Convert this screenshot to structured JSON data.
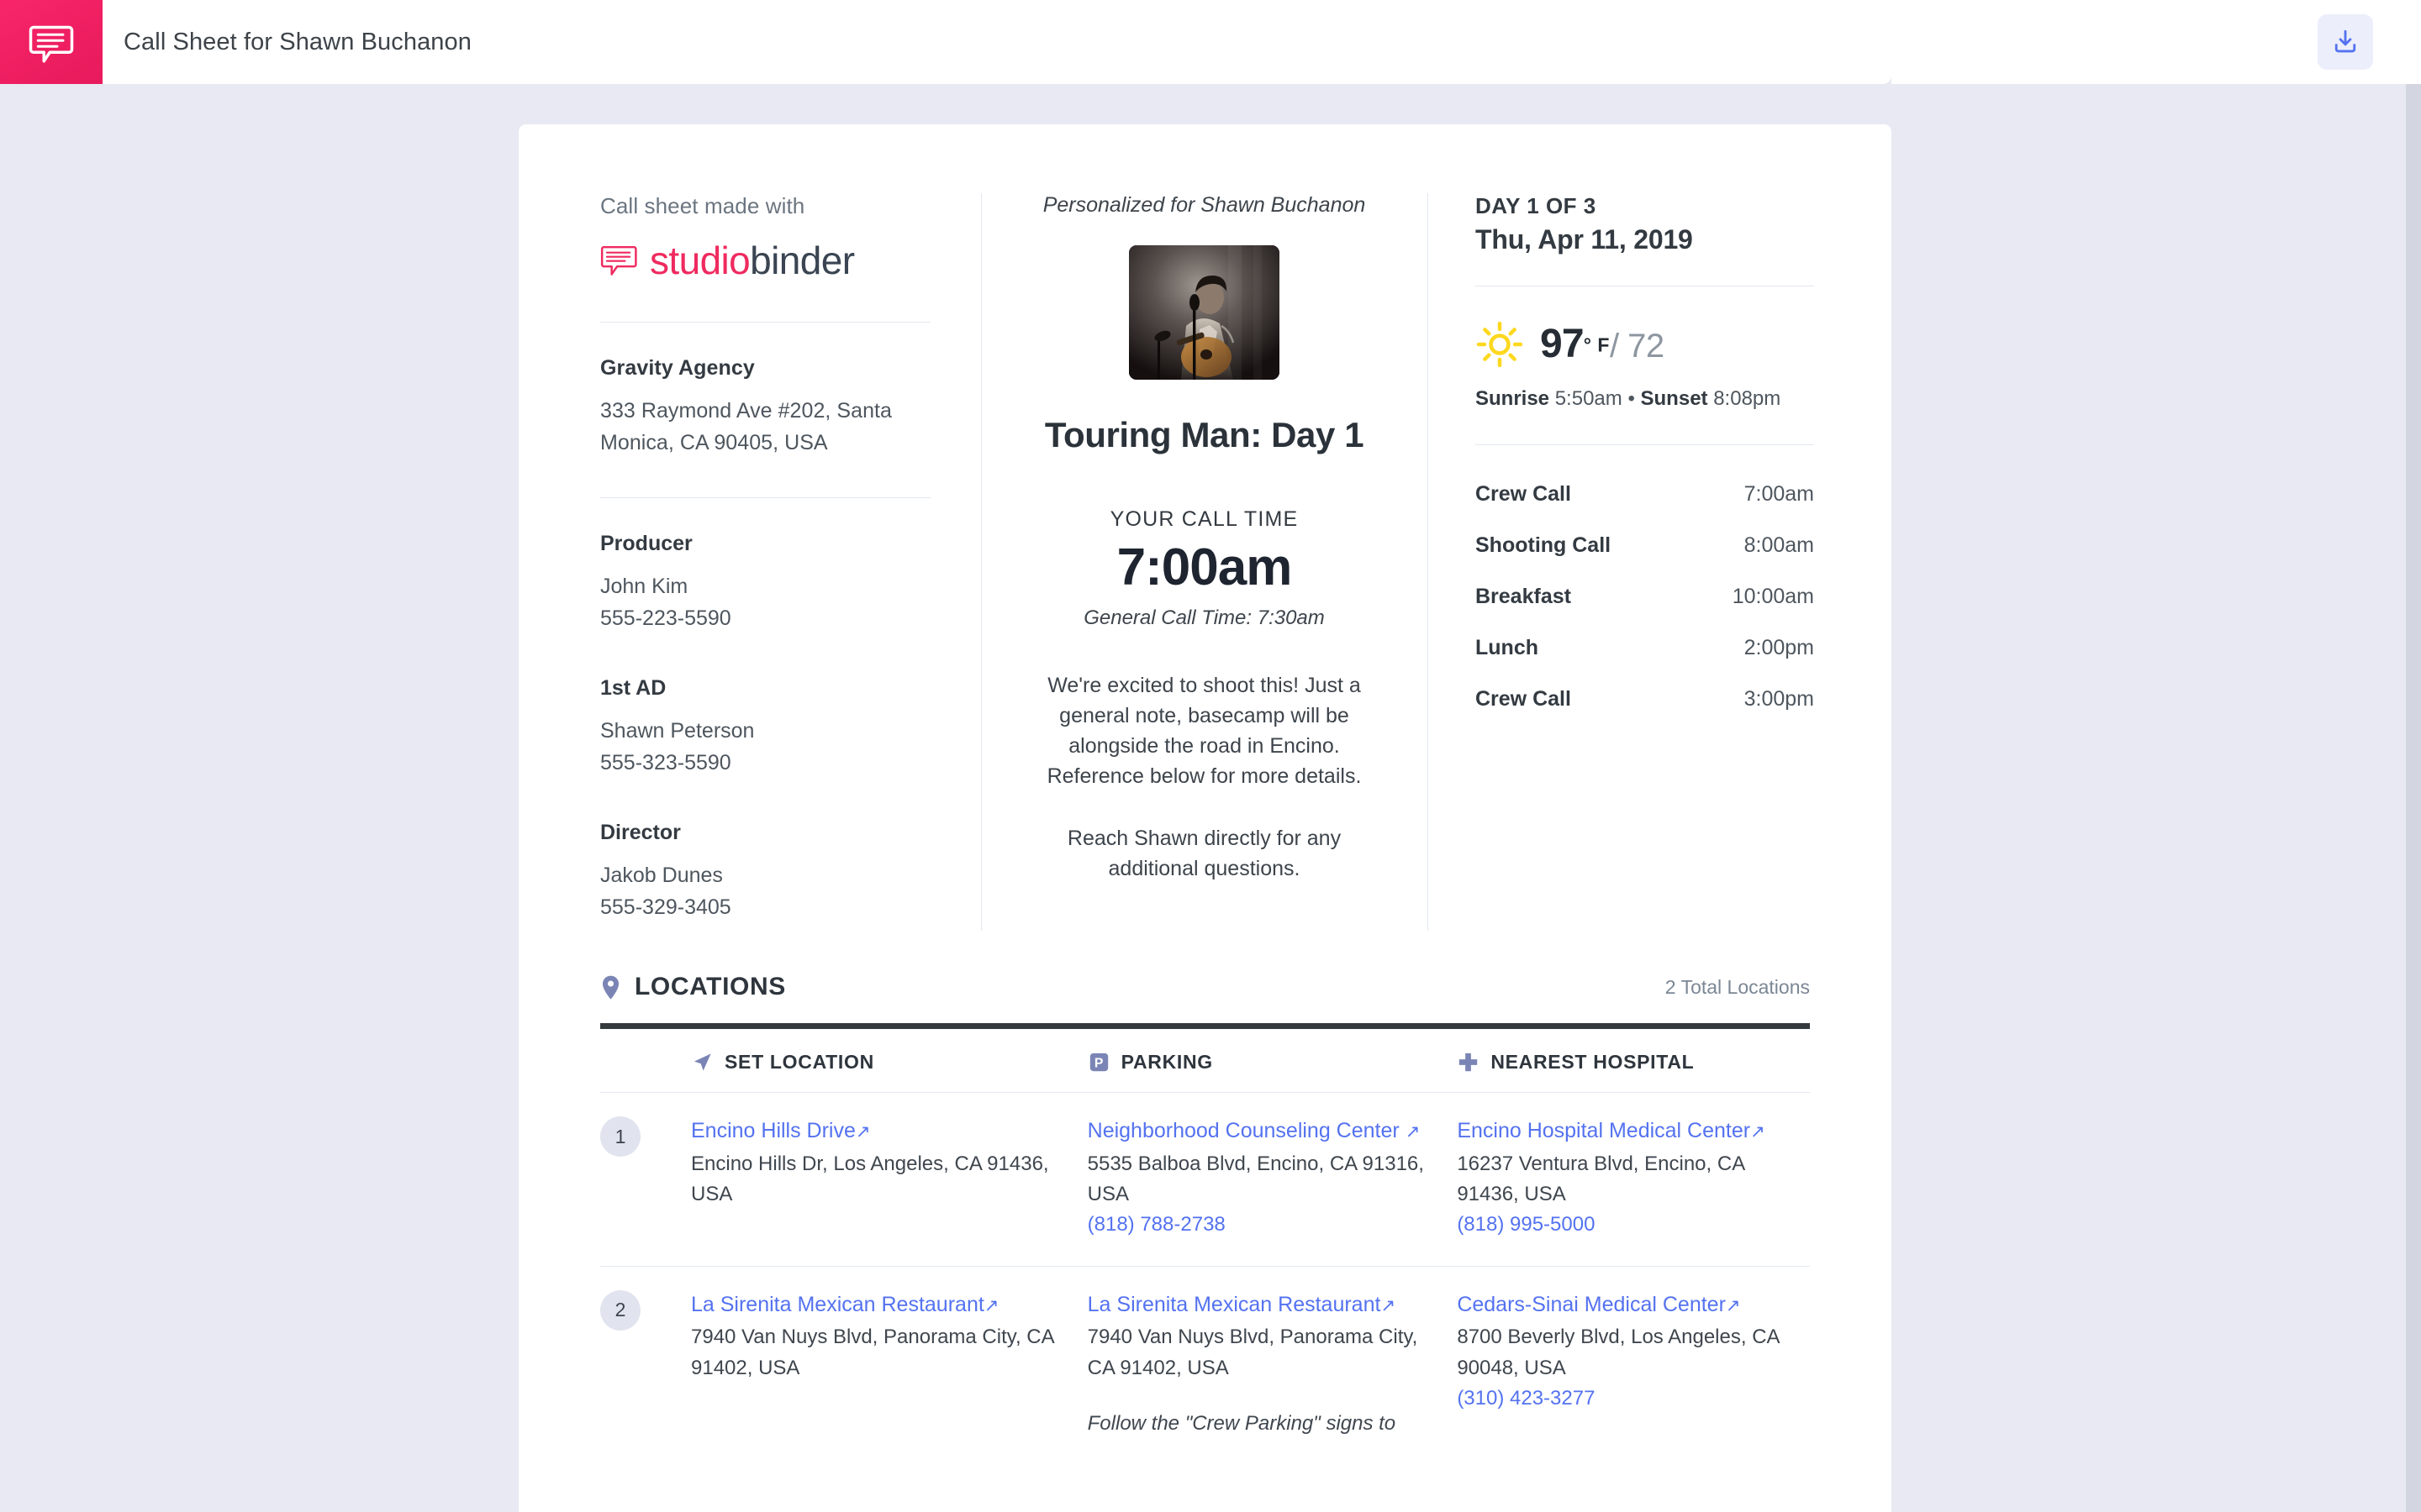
{
  "topbar": {
    "title": "Call Sheet for Shawn Buchanon",
    "brand_icon": "studiobinder-speech-bubble-icon",
    "brand_color": "#ef1f62",
    "download_icon": "download-icon",
    "download_color": "#5472f0"
  },
  "left": {
    "made_with": "Call sheet made with",
    "logo_icon": "studiobinder-logo-icon",
    "logo_part_1": "studio",
    "logo_part_2": "binder",
    "agency": {
      "name": "Gravity Agency",
      "address_line_1": "333 Raymond Ave #202, Santa",
      "address_line_2": "Monica, CA 90405, USA"
    },
    "contacts": [
      {
        "role": "Producer",
        "name": "John Kim",
        "phone": "555-223-5590"
      },
      {
        "role": "1st AD",
        "name": "Shawn Peterson",
        "phone": "555-323-5590"
      },
      {
        "role": "Director",
        "name": "Jakob Dunes",
        "phone": "555-329-3405"
      }
    ]
  },
  "mid": {
    "personalized": "Personalized for Shawn Buchanon",
    "thumbnail_icon": "musician-with-guitar-photo",
    "project_title": "Touring Man: Day 1",
    "call_time_label": "YOUR CALL TIME",
    "call_time": "7:00am",
    "general_call": "General Call Time: 7:30am",
    "note_1": "We're excited to shoot this! Just a general note, basecamp will be alongside the road in Encino. Reference below for more details.",
    "note_2": "Reach Shawn directly for any additional questions."
  },
  "right": {
    "day_of": "DAY 1 OF 3",
    "date": "Thu, Apr 11, 2019",
    "weather_icon": "sun-icon",
    "weather_icon_color": "#fdd81e",
    "temp_high": "97",
    "temp_unit": "° F",
    "temp_low": "/ 72",
    "sunrise_label": "Sunrise",
    "sunrise": "5:50am",
    "separator": "•",
    "sunset_label": "Sunset",
    "sunset": "8:08pm",
    "schedule": [
      {
        "label": "Crew Call",
        "time": "7:00am"
      },
      {
        "label": "Shooting Call",
        "time": "8:00am"
      },
      {
        "label": "Breakfast",
        "time": "10:00am"
      },
      {
        "label": "Lunch",
        "time": "2:00pm"
      },
      {
        "label": "Crew Call",
        "time": "3:00pm"
      }
    ]
  },
  "locations": {
    "pin_icon": "map-pin-icon",
    "title": "LOCATIONS",
    "count": "2 Total Locations",
    "columns": [
      {
        "icon": "navigation-arrow-icon",
        "label": "SET LOCATION"
      },
      {
        "icon": "parking-p-icon",
        "label": "PARKING"
      },
      {
        "icon": "medical-cross-icon",
        "label": "NEAREST HOSPITAL"
      }
    ],
    "rows": [
      {
        "number": "1",
        "set": {
          "name": "Encino Hills Drive",
          "address": "Encino Hills Dr, Los Angeles, CA 91436, USA"
        },
        "parking": {
          "name": "Neighborhood Counseling Center",
          "address": "5535 Balboa Blvd, Encino, CA 91316, USA",
          "phone": "(818) 788-2738"
        },
        "hospital": {
          "name": "Encino Hospital Medical Center",
          "address": "16237 Ventura Blvd, Encino, CA 91436, USA",
          "phone": "(818) 995-5000"
        }
      },
      {
        "number": "2",
        "set": {
          "name": "La Sirenita Mexican Restaurant",
          "address": "7940 Van Nuys Blvd, Panorama City, CA 91402, USA"
        },
        "parking": {
          "name": "La Sirenita Mexican Restaurant",
          "address": "7940 Van Nuys Blvd, Panorama City, CA 91402, USA",
          "note": "Follow the \"Crew Parking\" signs to"
        },
        "hospital": {
          "name": "Cedars-Sinai Medical Center",
          "address": "8700 Beverly Blvd, Los Angeles, CA 90048, USA",
          "phone": "(310) 423-3277"
        }
      }
    ],
    "external_link_glyph": "↗"
  }
}
